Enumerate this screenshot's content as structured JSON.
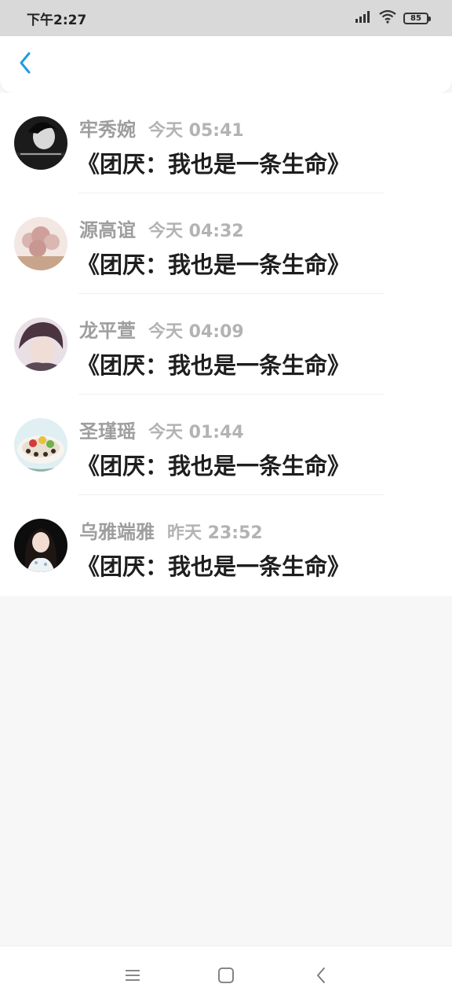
{
  "status_bar": {
    "time": "下午2:27",
    "battery": "85",
    "icons": [
      "signal-icon",
      "wifi-icon",
      "battery-icon"
    ]
  },
  "header": {
    "back_icon": "chevron-left-icon",
    "accent_color": "#1e9be8"
  },
  "items": [
    {
      "name": "牢秀婉",
      "time": "今天 05:41",
      "title": "《团厌：我也是一条生命》",
      "avatar": "avatar-dark-portrait"
    },
    {
      "name": "源高谊",
      "time": "今天 04:32",
      "title": "《团厌：我也是一条生命》",
      "avatar": "avatar-flowers"
    },
    {
      "name": "龙平萱",
      "time": "今天 04:09",
      "title": "《团厌：我也是一条生命》",
      "avatar": "avatar-anime"
    },
    {
      "name": "圣瑾瑶",
      "time": "今天 01:44",
      "title": "《团厌：我也是一条生命》",
      "avatar": "avatar-dessert"
    },
    {
      "name": "乌雅端雅",
      "time": "昨天 23:52",
      "title": "《团厌：我也是一条生命》",
      "avatar": "avatar-girl"
    }
  ],
  "nav_bar": {
    "menu_icon": "menu-icon",
    "home_icon": "home-square-icon",
    "back_icon": "back-chevron-icon"
  }
}
